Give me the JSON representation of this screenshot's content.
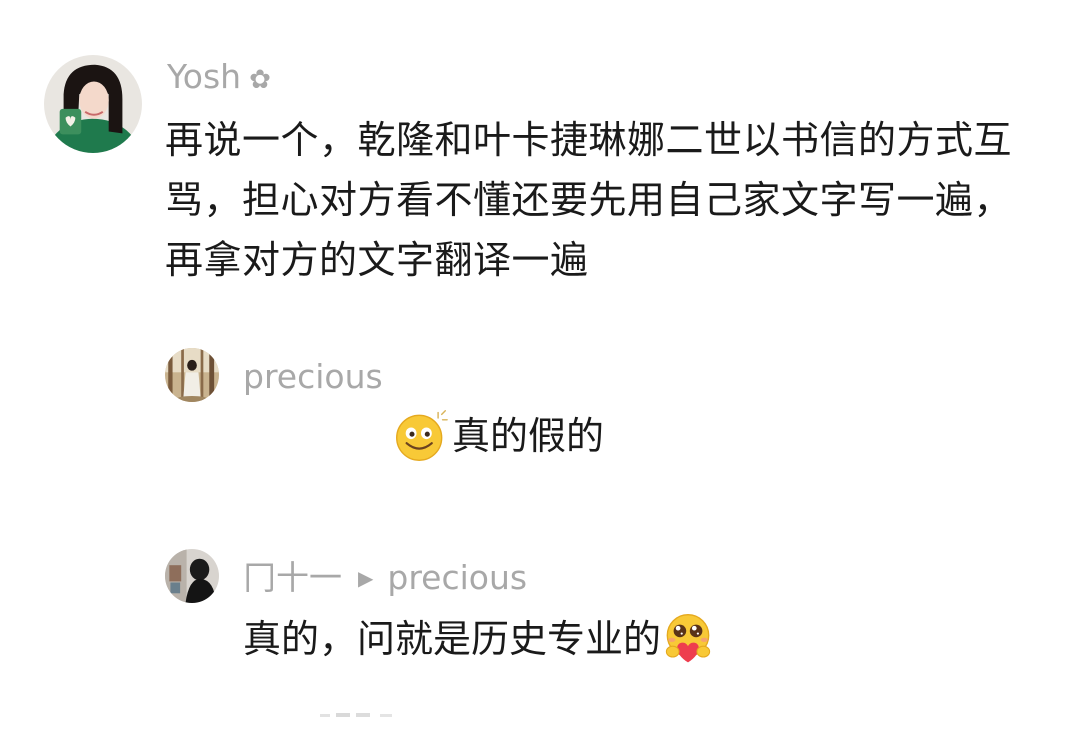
{
  "comments": [
    {
      "username": "Yosh",
      "user_icon": "flower-icon",
      "text": "再说一个，乾隆和叶卡捷琳娜二世以书信的方式互骂，担心对方看不懂还要先用自己家文字写一遍，再拿对方的文字翻译一遍"
    },
    {
      "username": "precious",
      "emoji": "grinning-sparkle-emoji",
      "text": "真的假的"
    },
    {
      "username": "冂十一",
      "reply_arrow": "▶",
      "reply_to": "precious",
      "text": "真的，问就是历史专业的",
      "emoji": "hug-heart-emoji"
    }
  ],
  "colors": {
    "username": "#a8a8a8",
    "text": "#1a1a1a",
    "emoji_yellow": "#f8c937",
    "heart": "#ee3d4e"
  }
}
